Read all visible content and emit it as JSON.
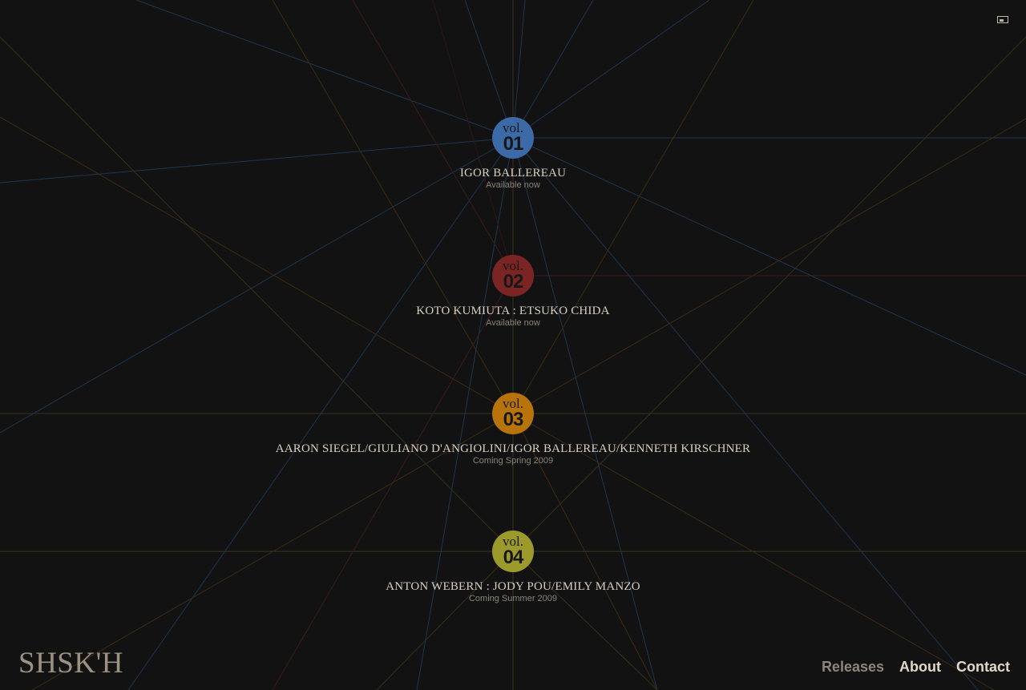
{
  "site": {
    "logo": "SHSK'H"
  },
  "nav": {
    "items": [
      {
        "label": "Releases",
        "active": true
      },
      {
        "label": "About",
        "active": false
      },
      {
        "label": "Contact",
        "active": false
      }
    ]
  },
  "colors": {
    "background": "#121212",
    "vol01": "#3b6aa6",
    "vol02": "#7a2424",
    "vol03": "#b8740a",
    "vol04": "#9c9a2a",
    "text_light": "#d9cfbf",
    "text_muted": "#8a8378",
    "nav_active": "#8e8678"
  },
  "releases": [
    {
      "vol_label": "vol.",
      "number": "01",
      "title": "IGOR BALLEREAU",
      "status": "Available now"
    },
    {
      "vol_label": "vol.",
      "number": "02",
      "title": "KOTO KUMIUTA : ETSUKO CHIDA",
      "status": "Available now"
    },
    {
      "vol_label": "vol.",
      "number": "03",
      "title": "AARON SIEGEL/GIULIANO D'ANGIOLINI/IGOR BALLEREAU/KENNETH KIRSCHNER",
      "status": "Coming Spring 2009"
    },
    {
      "vol_label": "vol.",
      "number": "04",
      "title": "ANTON WEBERN : JODY POU/EMILY MANZO",
      "status": "Coming Summer 2009"
    }
  ],
  "icons": {
    "fullscreen": "fullscreen-toggle-icon"
  }
}
